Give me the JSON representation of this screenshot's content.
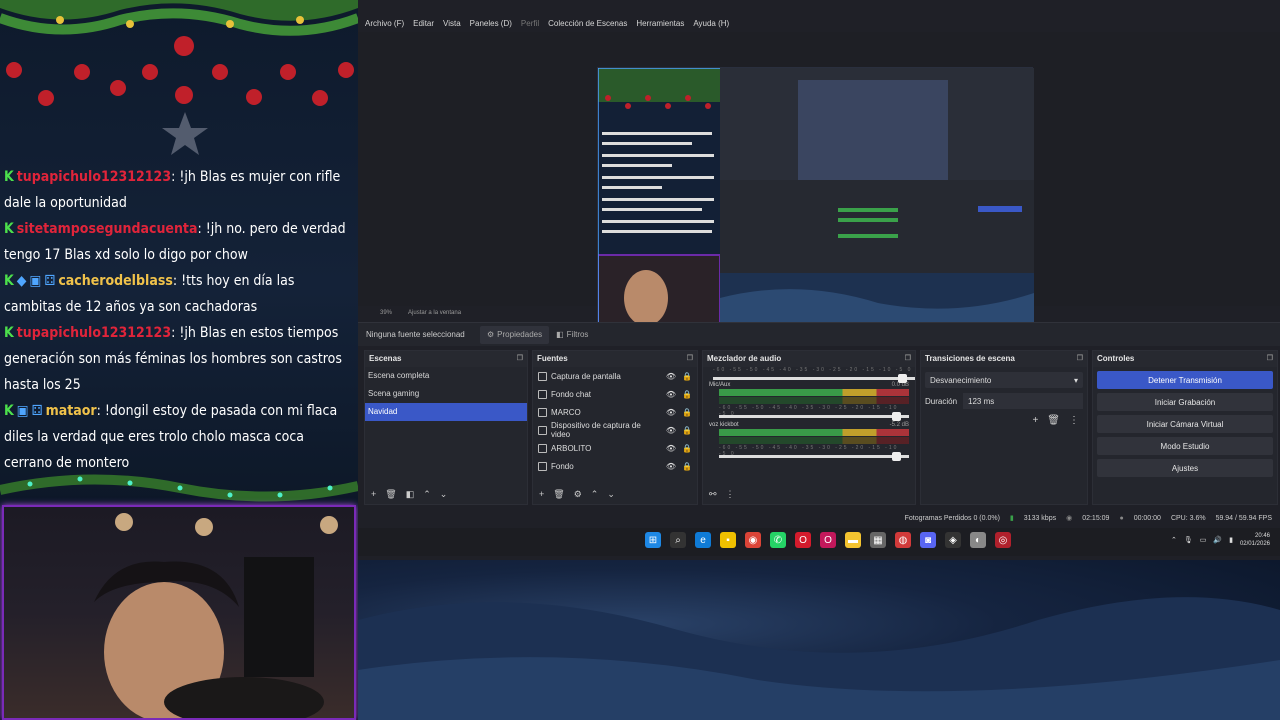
{
  "chat": {
    "messages": [
      {
        "user": "tupapichulo12312123",
        "user_color": "#e0243a",
        "text": ": !jh Blas es mujer con rifle dale la oportunidad",
        "badges": [
          "K"
        ]
      },
      {
        "user": "sitetamposegundacuenta",
        "user_color": "#e0243a",
        "text": ": !jh no. pero de verdad tengo 17 Blas xd solo lo digo por chow",
        "badges": [
          "K"
        ]
      },
      {
        "user": "cacherodelblass",
        "user_color": "#f0c24a",
        "text": ": !tts hoy en día las cambitas de 12 años ya son cachadoras",
        "badges": [
          "K",
          "◆",
          "▣",
          "⚃"
        ]
      },
      {
        "user": "tupapichulo12312123",
        "user_color": "#e0243a",
        "text": ": !jh Blas en estos tiempos generación son más féminas los hombres son castros hasta los 25",
        "badges": [
          "K"
        ]
      },
      {
        "user": "mataor",
        "user_color": "#f0c24a",
        "text": ": !dongil estoy de pasada con mi flaca diles la verdad que eres trolo cholo masca coca cerrano de montero",
        "badges": [
          "K",
          "▣",
          "⚃"
        ]
      }
    ]
  },
  "obs": {
    "menu": [
      "Archivo (F)",
      "Editar",
      "Vista",
      "Paneles (D)",
      "Perfil",
      "Colección de Escenas",
      "Herramientas",
      "Ayuda (H)"
    ],
    "zoom": "39%",
    "fit_label": "Ajustar a la ventana",
    "no_source": "Ninguna fuente seleccionad",
    "properties": "Propiedades",
    "filters": "Filtros",
    "scenes_title": "Escenas",
    "scenes": [
      "Escena completa",
      "Scena gaming",
      "Navidad"
    ],
    "selected_scene": 2,
    "sources_title": "Fuentes",
    "sources": [
      "Captura de pantalla",
      "Fondo chat",
      "MARCO",
      "Dispositivo de captura de video",
      "ARBOLITO",
      "Fondo"
    ],
    "mixer_title": "Mezclador de audio",
    "mixer": [
      {
        "name": "Mic/Aux",
        "db": "0.0 dB"
      },
      {
        "name": "voz kickbot",
        "db": "-5.2 dB"
      }
    ],
    "mixer_scale": "-60 -55 -50 -45 -40 -35 -30 -25 -20 -15 -10 -5 0",
    "transitions_title": "Transiciones de escena",
    "transition": "Desvanecimiento",
    "duration_label": "Duración",
    "duration_value": "123 ms",
    "controls_title": "Controles",
    "controls": [
      "Detener Transmisión",
      "Iniciar Grabación",
      "Iniciar Cámara Virtual",
      "Modo Estudio",
      "Ajustes"
    ],
    "status": {
      "dropped": "Fotogramas Perdidos 0 (0.0%)",
      "bitrate": "3133 kbps",
      "live_time": "02:15:09",
      "rec_time": "00:00:00",
      "cpu": "CPU: 3.6%",
      "fps": "59.94 / 59.94 FPS"
    }
  },
  "taskbar": {
    "time": "20:46",
    "date": "02/01/2026",
    "icons": [
      "windows-start-icon",
      "search-icon",
      "edge-icon",
      "notes-icon",
      "chrome-icon",
      "whatsapp-icon",
      "opera-icon",
      "opera-gx-icon",
      "folder-icon",
      "store-icon",
      "app-icon",
      "discord-icon",
      "steam-icon",
      "media-icon",
      "obs-icon"
    ]
  },
  "colors": {
    "accent": "#3a58c7",
    "frame": "#7a2ab8"
  }
}
